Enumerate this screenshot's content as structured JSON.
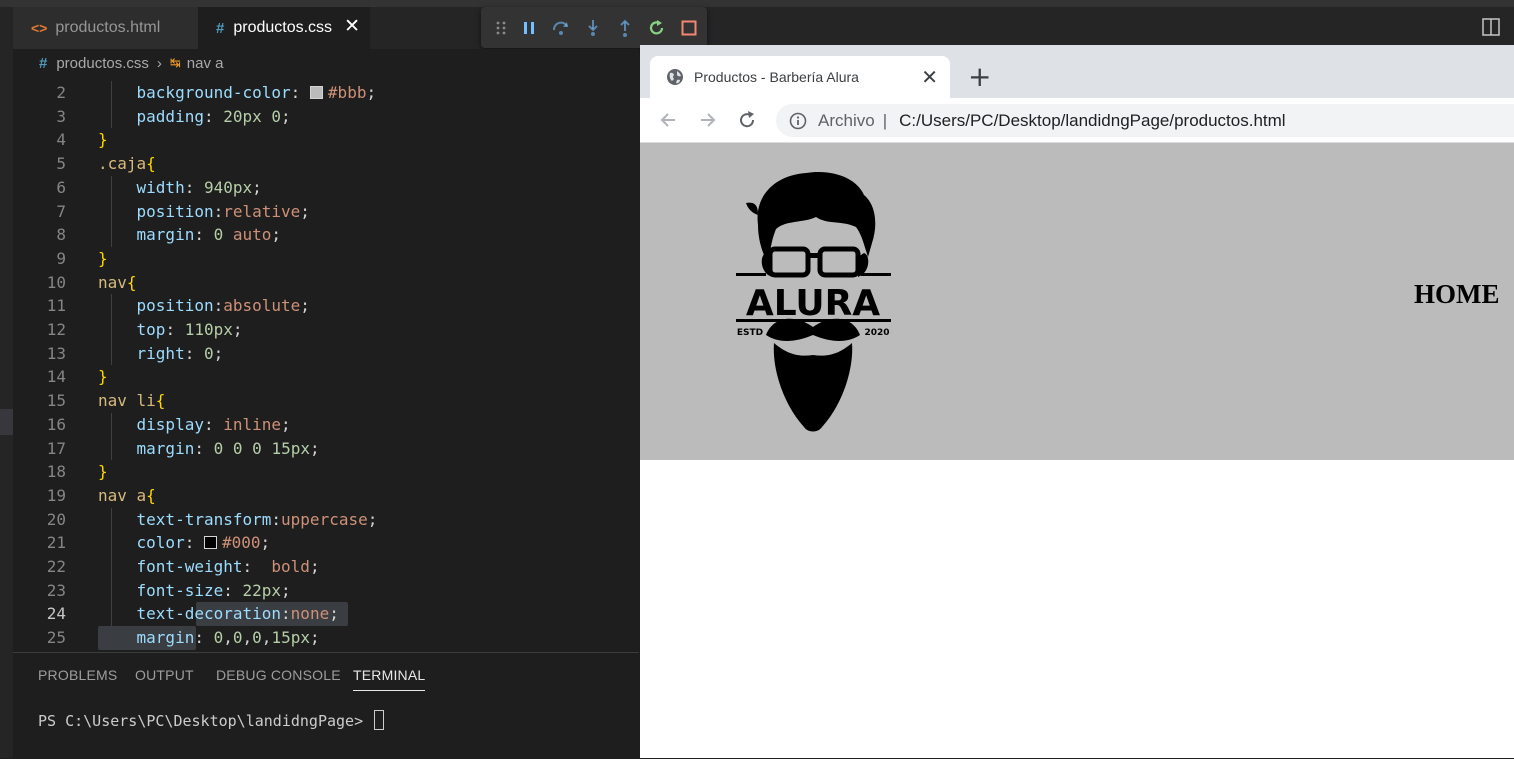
{
  "editor": {
    "tabs": [
      {
        "label": "productos.html",
        "icon": "html-file-icon",
        "active": false
      },
      {
        "label": "productos.css",
        "icon": "css-file-icon",
        "active": true
      }
    ],
    "close_glyph": "✕",
    "breadcrumb": {
      "file": "productos.css",
      "symbol": "nav a",
      "sep": "›"
    },
    "lines": [
      {
        "n": "2",
        "tokens": [
          [
            "    ",
            "pun"
          ],
          [
            "background-color",
            "prop"
          ],
          [
            ": ",
            "pun"
          ],
          [
            "SW:#bbbbbb",
            ""
          ],
          [
            "#bbb",
            "val"
          ],
          [
            ";",
            "pun"
          ]
        ]
      },
      {
        "n": "3",
        "tokens": [
          [
            "    ",
            "pun"
          ],
          [
            "padding",
            "prop"
          ],
          [
            ": ",
            "pun"
          ],
          [
            "20px",
            "num"
          ],
          [
            " ",
            "pun"
          ],
          [
            "0",
            "num"
          ],
          [
            ";",
            "pun"
          ]
        ]
      },
      {
        "n": "4",
        "tokens": [
          [
            "}",
            "brace"
          ]
        ]
      },
      {
        "n": "5",
        "tokens": [
          [
            ".caja",
            "sel"
          ],
          [
            "{",
            "brace"
          ]
        ]
      },
      {
        "n": "6",
        "tokens": [
          [
            "    ",
            "pun"
          ],
          [
            "width",
            "prop"
          ],
          [
            ": ",
            "pun"
          ],
          [
            "940px",
            "num"
          ],
          [
            ";",
            "pun"
          ]
        ]
      },
      {
        "n": "7",
        "tokens": [
          [
            "    ",
            "pun"
          ],
          [
            "position",
            "prop"
          ],
          [
            ":",
            "pun"
          ],
          [
            "relative",
            "val"
          ],
          [
            ";",
            "pun"
          ]
        ]
      },
      {
        "n": "8",
        "tokens": [
          [
            "    ",
            "pun"
          ],
          [
            "margin",
            "prop"
          ],
          [
            ": ",
            "pun"
          ],
          [
            "0",
            "num"
          ],
          [
            " ",
            "pun"
          ],
          [
            "auto",
            "val"
          ],
          [
            ";",
            "pun"
          ]
        ]
      },
      {
        "n": "9",
        "tokens": [
          [
            "}",
            "brace"
          ]
        ]
      },
      {
        "n": "10",
        "tokens": [
          [
            "nav",
            "sel"
          ],
          [
            "{",
            "brace"
          ]
        ]
      },
      {
        "n": "11",
        "tokens": [
          [
            "    ",
            "pun"
          ],
          [
            "position",
            "prop"
          ],
          [
            ":",
            "pun"
          ],
          [
            "absolute",
            "val"
          ],
          [
            ";",
            "pun"
          ]
        ]
      },
      {
        "n": "12",
        "tokens": [
          [
            "    ",
            "pun"
          ],
          [
            "top",
            "prop"
          ],
          [
            ": ",
            "pun"
          ],
          [
            "110px",
            "num"
          ],
          [
            ";",
            "pun"
          ]
        ]
      },
      {
        "n": "13",
        "tokens": [
          [
            "    ",
            "pun"
          ],
          [
            "right",
            "prop"
          ],
          [
            ": ",
            "pun"
          ],
          [
            "0",
            "num"
          ],
          [
            ";",
            "pun"
          ]
        ]
      },
      {
        "n": "14",
        "tokens": [
          [
            "}",
            "brace"
          ]
        ]
      },
      {
        "n": "15",
        "tokens": [
          [
            "nav li",
            "sel"
          ],
          [
            "{",
            "brace"
          ]
        ]
      },
      {
        "n": "16",
        "tokens": [
          [
            "    ",
            "pun"
          ],
          [
            "display",
            "prop"
          ],
          [
            ": ",
            "pun"
          ],
          [
            "inline",
            "val"
          ],
          [
            ";",
            "pun"
          ]
        ]
      },
      {
        "n": "17",
        "tokens": [
          [
            "    ",
            "pun"
          ],
          [
            "margin",
            "prop"
          ],
          [
            ": ",
            "pun"
          ],
          [
            "0",
            "num"
          ],
          [
            " ",
            "pun"
          ],
          [
            "0",
            "num"
          ],
          [
            " ",
            "pun"
          ],
          [
            "0",
            "num"
          ],
          [
            " ",
            "pun"
          ],
          [
            "15px",
            "num"
          ],
          [
            ";",
            "pun"
          ]
        ]
      },
      {
        "n": "18",
        "tokens": [
          [
            "}",
            "brace"
          ]
        ]
      },
      {
        "n": "19",
        "tokens": [
          [
            "nav a",
            "sel"
          ],
          [
            "{",
            "brace"
          ]
        ]
      },
      {
        "n": "20",
        "tokens": [
          [
            "    ",
            "pun"
          ],
          [
            "text-transform",
            "prop"
          ],
          [
            ":",
            "pun"
          ],
          [
            "uppercase",
            "val"
          ],
          [
            ";",
            "pun"
          ]
        ]
      },
      {
        "n": "21",
        "tokens": [
          [
            "    ",
            "pun"
          ],
          [
            "color",
            "prop"
          ],
          [
            ": ",
            "pun"
          ],
          [
            "SW:#000000",
            ""
          ],
          [
            "#000",
            "val"
          ],
          [
            ";",
            "pun"
          ]
        ]
      },
      {
        "n": "22",
        "tokens": [
          [
            "    ",
            "pun"
          ],
          [
            "font-weight",
            "prop"
          ],
          [
            ":  ",
            "pun"
          ],
          [
            "bold",
            "val"
          ],
          [
            ";",
            "pun"
          ]
        ]
      },
      {
        "n": "23",
        "tokens": [
          [
            "    ",
            "pun"
          ],
          [
            "font-size",
            "prop"
          ],
          [
            ": ",
            "pun"
          ],
          [
            "22px",
            "num"
          ],
          [
            ";",
            "pun"
          ]
        ]
      },
      {
        "n": "24",
        "active": true,
        "tokens": [
          [
            "    ",
            "pun"
          ],
          [
            "text-decoration",
            "prop"
          ],
          [
            ":",
            "pun"
          ],
          [
            "none",
            "val"
          ],
          [
            ";",
            "pun"
          ]
        ]
      },
      {
        "n": "25",
        "tokens": [
          [
            "    ",
            "pun"
          ],
          [
            "margin",
            "prop"
          ],
          [
            ": ",
            "pun"
          ],
          [
            "0",
            "num"
          ],
          [
            ",",
            "pun"
          ],
          [
            "0",
            "num"
          ],
          [
            ",",
            "pun"
          ],
          [
            "0",
            "num"
          ],
          [
            ",",
            "pun"
          ],
          [
            "15px",
            "num"
          ],
          [
            ";",
            "pun"
          ]
        ]
      }
    ],
    "panel_tabs": [
      "PROBLEMS",
      "OUTPUT",
      "DEBUG CONSOLE",
      "TERMINAL"
    ],
    "active_panel_tab": "TERMINAL",
    "terminal_prompt": "PS C:\\Users\\PC\\Desktop\\landidngPage> "
  },
  "browser": {
    "tab_title": "Productos - Barbería Alura",
    "new_tab": "+",
    "address_label": "Archivo",
    "address_sep": "|",
    "url": "C:/Users/PC/Desktop/landidngPage/productos.html",
    "page": {
      "header_color": "#bbbbbb",
      "logo": {
        "word": "ALURA",
        "left": "ESTD",
        "right": "2020"
      },
      "nav_item": "home"
    }
  },
  "colors": {
    "accent": "#0e639c",
    "debug_play": "#75beff",
    "debug_restart": "#89d185",
    "debug_stop": "#f48771"
  }
}
